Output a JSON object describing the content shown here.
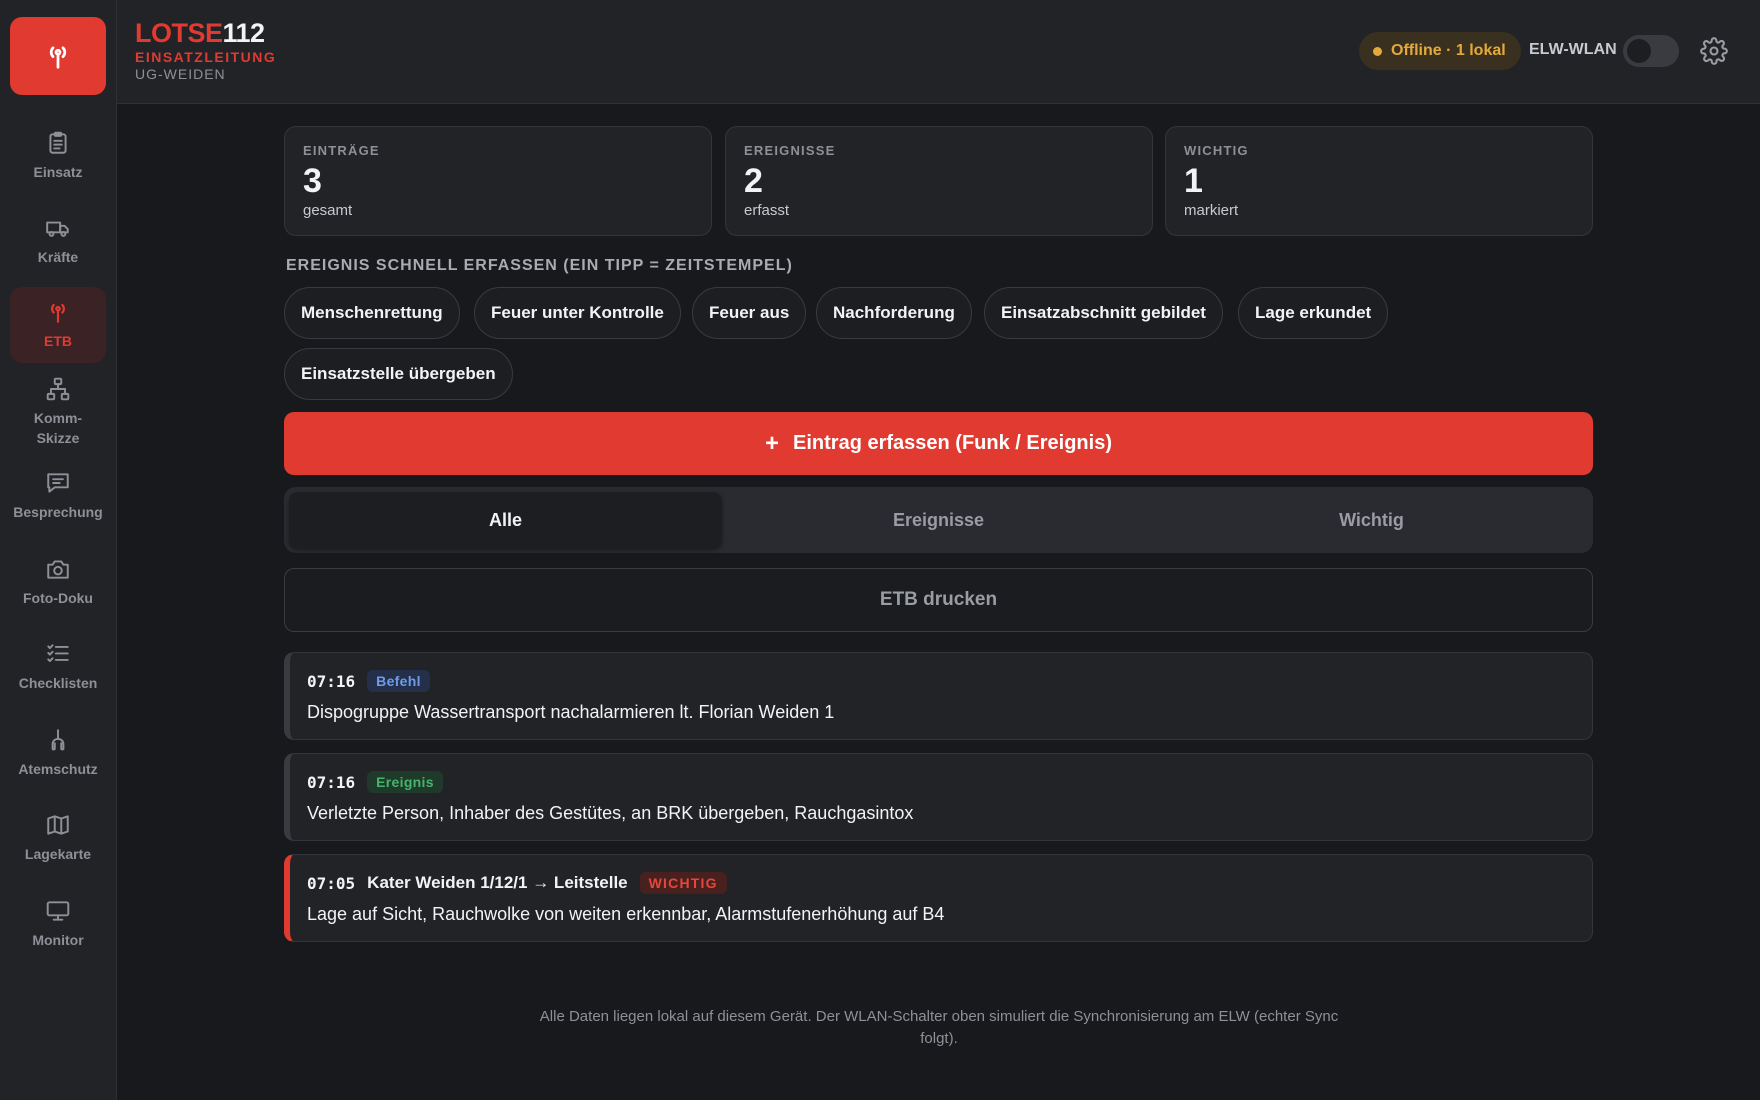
{
  "app": {
    "name_red": "LOTSE",
    "name_white": "112",
    "subtitle": "EINSATZLEITUNG",
    "unit": "UG-WEIDEN"
  },
  "header": {
    "status": "Offline · 1 lokal",
    "wlan_label": "ELW-WLAN",
    "wlan_on": false
  },
  "colors": {
    "accent": "#e03a31",
    "warning": "#e4a93a",
    "info": "#6f9be8",
    "success": "#46b46a"
  },
  "sidebar": {
    "items": [
      {
        "label": "Einsatz",
        "icon": "clipboard-icon",
        "active": false
      },
      {
        "label": "Kräfte",
        "icon": "truck-icon",
        "active": false
      },
      {
        "label": "ETB",
        "icon": "antenna-icon",
        "active": true
      },
      {
        "label": "Komm-\nSkizze",
        "icon": "org-chart-icon",
        "active": false
      },
      {
        "label": "Besprechung",
        "icon": "chat-icon",
        "active": false
      },
      {
        "label": "Foto-Doku",
        "icon": "camera-icon",
        "active": false
      },
      {
        "label": "Checklisten",
        "icon": "checklist-icon",
        "active": false
      },
      {
        "label": "Atemschutz",
        "icon": "breathing-icon",
        "active": false
      },
      {
        "label": "Lagekarte",
        "icon": "map-icon",
        "active": false
      },
      {
        "label": "Monitor",
        "icon": "monitor-icon",
        "active": false
      }
    ]
  },
  "stats": [
    {
      "label": "EINTRÄGE",
      "value": "3",
      "sub": "gesamt"
    },
    {
      "label": "EREIGNISSE",
      "value": "2",
      "sub": "erfasst"
    },
    {
      "label": "WICHTIG",
      "value": "1",
      "sub": "markiert"
    }
  ],
  "quick": {
    "heading": "EREIGNIS SCHNELL ERFASSEN (EIN TIPP = ZEITSTEMPEL)",
    "chips": [
      "Menschenrettung",
      "Feuer unter Kontrolle",
      "Feuer aus",
      "Nachforderung",
      "Einsatzabschnitt gebildet",
      "Lage erkundet",
      "Einsatzstelle übergeben"
    ]
  },
  "primary_button": {
    "plus": "+",
    "label": "Eintrag erfassen (Funk / Ereignis)"
  },
  "tabs": [
    {
      "label": "Alle",
      "active": true
    },
    {
      "label": "Ereignisse",
      "active": false
    },
    {
      "label": "Wichtig",
      "active": false
    }
  ],
  "print_button": "ETB drucken",
  "entries": [
    {
      "time": "07:16",
      "route": "",
      "badge": "Befehl",
      "badge_type": "befehl",
      "text": "Dispogruppe Wassertransport nachalarmieren lt. Florian Weiden 1"
    },
    {
      "time": "07:16",
      "route": "",
      "badge": "Ereignis",
      "badge_type": "ereignis",
      "text": "Verletzte Person, Inhaber des Gestütes, an BRK übergeben, Rauchgasintox"
    },
    {
      "time": "07:05",
      "route": "Kater Weiden 1/12/1 → Leitstelle",
      "badge": "WICHTIG",
      "badge_type": "wichtig",
      "text": "Lage auf Sicht, Rauchwolke von weiten erkennbar, Alarmstufenerhöhung auf B4"
    }
  ],
  "footer": "Alle Daten liegen lokal auf diesem Gerät. Der WLAN-Schalter oben simuliert die Synchronisierung am ELW (echter Sync folgt)."
}
